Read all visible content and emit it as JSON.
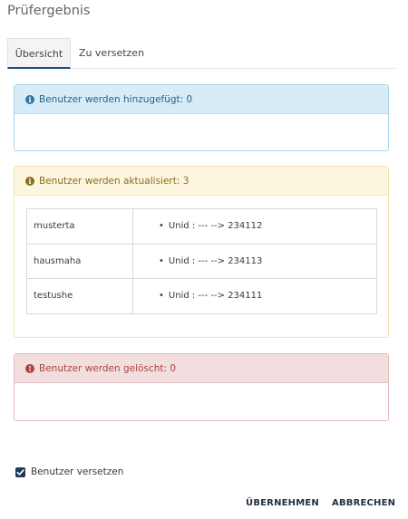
{
  "dialog": {
    "title": "Prüfergebnis"
  },
  "tabs": [
    {
      "label": "Übersicht",
      "active": true
    },
    {
      "label": "Zu versetzen",
      "active": false
    }
  ],
  "panels": {
    "added": {
      "icon": "info-icon",
      "title": "Benutzer werden hinzugefügt: 0",
      "color": "#2f76a3"
    },
    "updated": {
      "icon": "info-icon",
      "title": "Benutzer werden aktualisiert: 3",
      "color": "#8a6b1f",
      "rows": [
        {
          "user": "musterta",
          "change": "Unid : --- --> 234112"
        },
        {
          "user": "hausmaha",
          "change": "Unid : --- --> 234113"
        },
        {
          "user": "testushe",
          "change": "Unid : --- --> 234111"
        }
      ]
    },
    "deleted": {
      "icon": "alert-icon",
      "title": "Benutzer werden gelöscht: 0",
      "color": "#a94442"
    }
  },
  "options": {
    "move_users_label": "Benutzer versetzen",
    "move_users_checked": true
  },
  "actions": {
    "apply_label": "ÜBERNEHMEN",
    "cancel_label": "ABBRECHEN"
  }
}
